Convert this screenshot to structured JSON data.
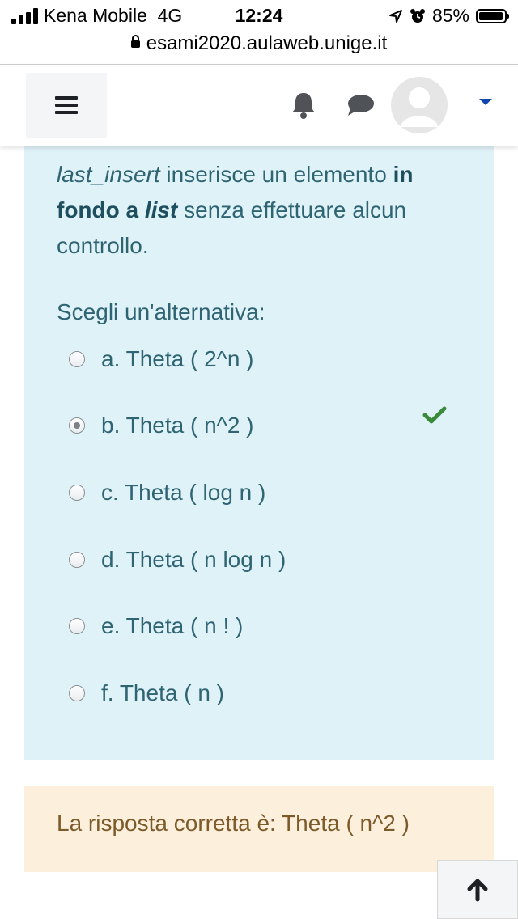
{
  "status_bar": {
    "carrier": "Kena Mobile",
    "network": "4G",
    "time": "12:24",
    "battery": "85%",
    "battery_level": 0.85
  },
  "url_bar": {
    "domain": "esami2020.aulaweb.unige.it"
  },
  "navbar": {
    "menu_icon": "hamburger-icon",
    "notification_icon": "bell-icon",
    "messages_icon": "chat-bubble-icon",
    "user_icon": "avatar",
    "user_menu_icon": "caret-down-icon"
  },
  "question": {
    "text_part1": "last_insert",
    "text_part2": " inserisce un elemento ",
    "text_part3": "in fondo a ",
    "text_part4": "list",
    "text_part5": " senza effettuare alcun controllo.",
    "prompt": "Scegli un'alternativa:",
    "options": [
      {
        "label": "a. Theta ( 2^n )",
        "selected": false
      },
      {
        "label": "b. Theta ( n^2 )",
        "selected": true,
        "correct": true
      },
      {
        "label": "c. Theta ( log n )",
        "selected": false
      },
      {
        "label": "d. Theta ( n log n )",
        "selected": false
      },
      {
        "label": "e. Theta ( n ! )",
        "selected": false
      },
      {
        "label": "f. Theta ( n )",
        "selected": false
      }
    ]
  },
  "feedback": {
    "correct_answer": "La risposta corretta è: Theta ( n^2 )"
  },
  "colors": {
    "question_bg": "#def2f8",
    "question_text": "#2f6473",
    "answer_bg": "#fcefdc",
    "answer_text": "#7d5a29",
    "check": "#3b8a3b",
    "accent": "#0f47ad"
  }
}
